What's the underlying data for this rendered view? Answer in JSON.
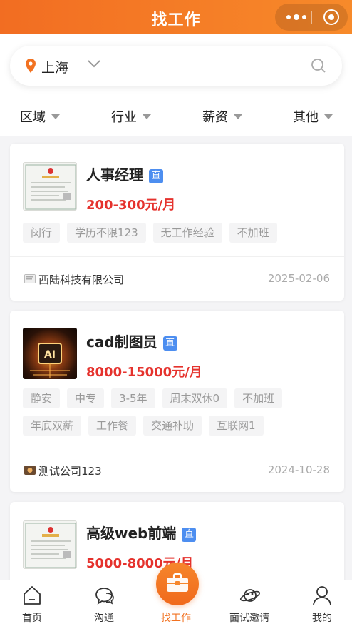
{
  "header": {
    "title": "找工作"
  },
  "search": {
    "city": "上海"
  },
  "filters": [
    "区域",
    "行业",
    "薪资",
    "其他"
  ],
  "jobs": [
    {
      "title": "人事经理",
      "badge": "直",
      "salary": "200-300元/月",
      "tags": [
        "闵行",
        "学历不限123",
        "无工作经验",
        "不加班"
      ],
      "company": "西陆科技有限公司",
      "date": "2025-02-06"
    },
    {
      "title": "cad制图员",
      "badge": "直",
      "salary": "8000-15000元/月",
      "tags": [
        "静安",
        "中专",
        "3-5年",
        "周末双休0",
        "不加班",
        "年底双薪",
        "工作餐",
        "交通补助",
        "互联网1"
      ],
      "company": "测试公司123",
      "date": "2024-10-28"
    },
    {
      "title": "高级web前端",
      "badge": "直",
      "salary": "5000-8000元/月"
    }
  ],
  "tabbar": {
    "items": [
      {
        "label": "首页",
        "icon": "home-icon"
      },
      {
        "label": "沟通",
        "icon": "chat-icon"
      },
      {
        "label": "找工作",
        "icon": "briefcase-icon",
        "active": true
      },
      {
        "label": "面试邀请",
        "icon": "planet-icon"
      },
      {
        "label": "我的",
        "icon": "user-icon"
      }
    ]
  },
  "colors": {
    "brand": "#f26d22",
    "salary": "#e5322d",
    "badge": "#4d8ef0"
  }
}
